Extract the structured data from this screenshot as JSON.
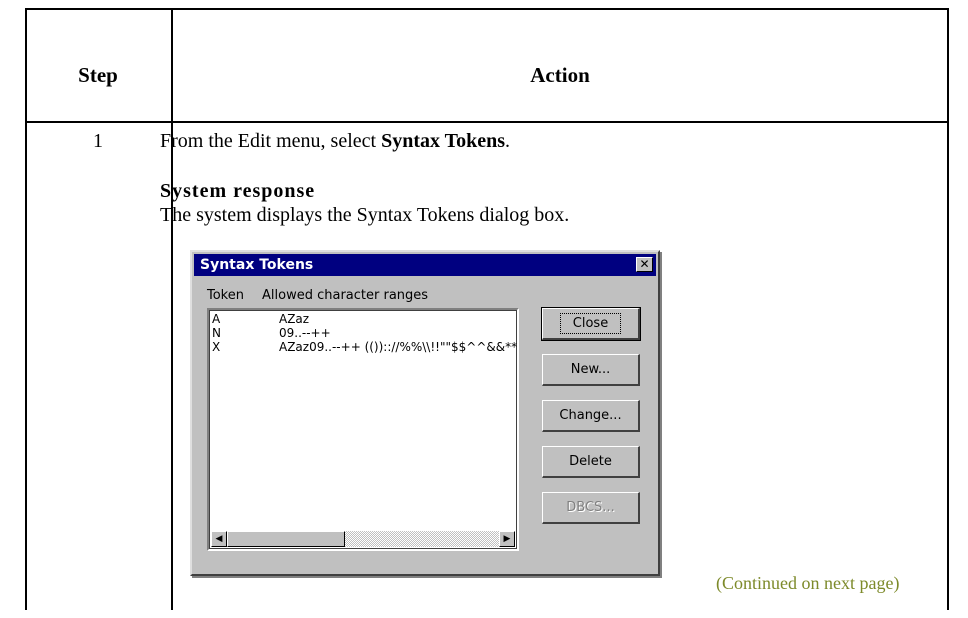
{
  "table": {
    "header_step": "Step",
    "header_action": "Action",
    "step_number": "1",
    "instruction_prefix": "From the Edit menu, select ",
    "instruction_bold": "Syntax Tokens",
    "instruction_suffix": ".",
    "system_response_title": "System response",
    "system_response_text": "The system displays the Syntax Tokens dialog box.",
    "continued": "(Continued on next page)",
    "continued_color": "#7d8a2a"
  },
  "dialog": {
    "title": "Syntax Tokens",
    "title_bar_color": "#000080",
    "close_glyph": "✕",
    "column_token": "Token",
    "column_ranges": "Allowed character ranges",
    "tokens": [
      {
        "token": "A",
        "ranges": "AZaz"
      },
      {
        "token": "N",
        "ranges": "09..--++"
      },
      {
        "token": "X",
        "ranges": "AZaz09..--++  (()):://%%\\\\!!\"\"$$^^&&**"
      }
    ],
    "scroll_left_icon": "◀",
    "scroll_right_icon": "▶",
    "buttons": {
      "close": "Close",
      "new": "New...",
      "change": "Change...",
      "delete": "Delete",
      "dbcs": "DBCS..."
    }
  }
}
